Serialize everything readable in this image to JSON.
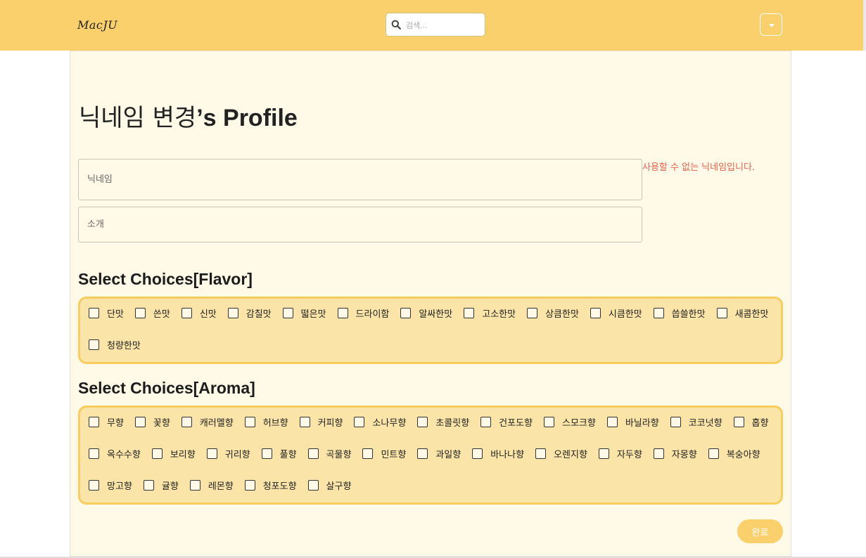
{
  "navbar": {
    "logo": "MacJU",
    "search": {
      "placeholder": "검색...",
      "value": ""
    },
    "menu_icon": "caret-down-icon",
    "color": "#f9d06b"
  },
  "profile": {
    "title_name": "닉네임 변경",
    "title_suffix": "’s Profile"
  },
  "form": {
    "nickname": {
      "placeholder": "닉네임",
      "value": ""
    },
    "intro": {
      "placeholder": "소개",
      "value": ""
    },
    "error": "사용할 수 없는 닉네임입니다."
  },
  "flavor": {
    "heading": "Select Choices[Flavor]",
    "options": [
      "단맛",
      "쓴맛",
      "신맛",
      "감칠맛",
      "떫은맛",
      "드라이함",
      "알싸한맛",
      "고소한맛",
      "상큼한맛",
      "시큼한맛",
      "씁쓸한맛",
      "새콤한맛",
      "청량한맛"
    ]
  },
  "aroma": {
    "heading": "Select Choices[Aroma]",
    "options": [
      "무향",
      "꽃향",
      "캐러멜향",
      "허브향",
      "커피향",
      "소나무향",
      "초콜릿향",
      "건포도향",
      "스모크향",
      "바닐라향",
      "코코넛향",
      "홉향",
      "옥수수향",
      "보리향",
      "귀리향",
      "풀향",
      "곡물향",
      "민트향",
      "과일향",
      "바나나향",
      "오렌지향",
      "자두향",
      "자몽향",
      "복숭아향",
      "망고향",
      "귤향",
      "레몬향",
      "청포도향",
      "살구향"
    ]
  },
  "submit_label": "완료",
  "colors": {
    "accent": "#f9d06b",
    "error": "#e8604c",
    "panel": "#fae4a8",
    "panel_border": "#f8cd5c",
    "card": "#fff9e8"
  }
}
